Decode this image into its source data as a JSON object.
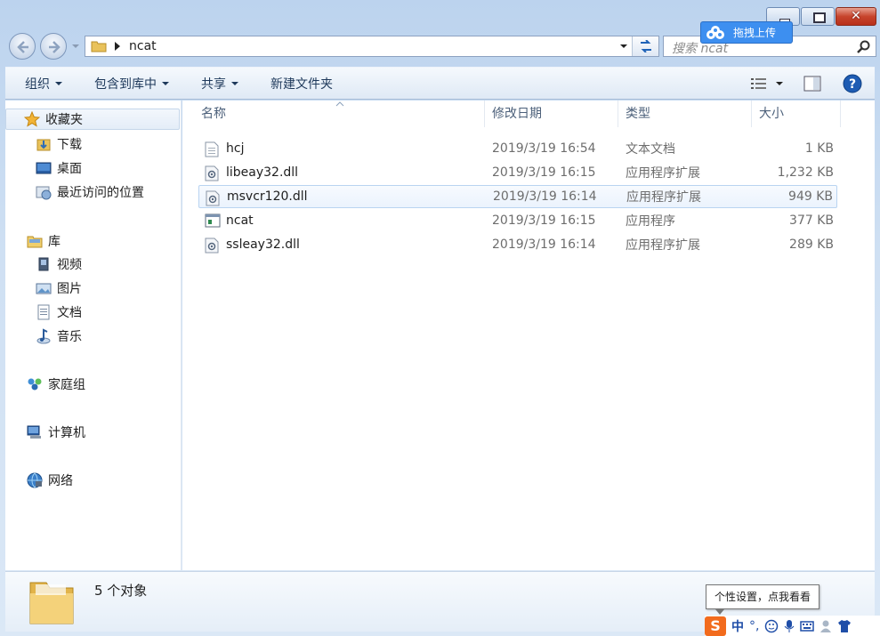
{
  "window": {
    "close_glyph": "✕"
  },
  "address": {
    "path": "ncat"
  },
  "search": {
    "placeholder": "搜索 ncat"
  },
  "cloud_widget": {
    "label": "拖拽上传"
  },
  "toolbar": {
    "organize": "组织",
    "include_library": "包含到库中",
    "share": "共享",
    "new_folder": "新建文件夹"
  },
  "nav": {
    "favorites": "收藏夹",
    "downloads": "下载",
    "desktop": "桌面",
    "recent": "最近访问的位置",
    "libraries": "库",
    "videos": "视频",
    "pictures": "图片",
    "documents": "文档",
    "music": "音乐",
    "homegroup": "家庭组",
    "computer": "计算机",
    "network": "网络"
  },
  "columns": {
    "name": "名称",
    "date": "修改日期",
    "type": "类型",
    "size": "大小"
  },
  "files": [
    {
      "name": "hcj",
      "date": "2019/3/19 16:54",
      "type": "文本文档",
      "size": "1 KB",
      "icon": "text-file-icon"
    },
    {
      "name": "libeay32.dll",
      "date": "2019/3/19 16:15",
      "type": "应用程序扩展",
      "size": "1,232 KB",
      "icon": "dll-file-icon"
    },
    {
      "name": "msvcr120.dll",
      "date": "2019/3/19 16:14",
      "type": "应用程序扩展",
      "size": "949 KB",
      "icon": "dll-file-icon",
      "selected": true
    },
    {
      "name": "ncat",
      "date": "2019/3/19 16:15",
      "type": "应用程序",
      "size": "377 KB",
      "icon": "exe-file-icon"
    },
    {
      "name": "ssleay32.dll",
      "date": "2019/3/19 16:14",
      "type": "应用程序扩展",
      "size": "289 KB",
      "icon": "dll-file-icon"
    }
  ],
  "details": {
    "count": "5 个对象"
  },
  "tooltip": {
    "text": "个性设置，点我看看"
  },
  "ime": {
    "logo": "S",
    "lang": "中",
    "punct": "°,"
  },
  "colors": {
    "accent": "#3d8ff0",
    "selection": "#ebf3fd",
    "ime_brand": "#f26b1d"
  }
}
